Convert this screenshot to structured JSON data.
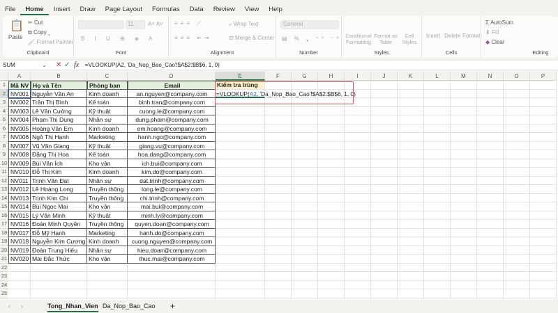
{
  "menu": [
    "File",
    "Home",
    "Insert",
    "Draw",
    "Page Layout",
    "Formulas",
    "Data",
    "Review",
    "View",
    "Help"
  ],
  "ribbon": {
    "clipboard": {
      "paste": "Paste",
      "cut": "Cut",
      "copy": "Copy",
      "format_painter": "Format Painter",
      "label": "Clipboard"
    },
    "font": {
      "size": "11",
      "label": "Font"
    },
    "alignment": {
      "wrap": "Wrap Text",
      "merge": "Merge & Center",
      "label": "Alignment"
    },
    "number": {
      "format": "General",
      "label": "Number"
    },
    "styles": {
      "conditional": "Conditional Formatting",
      "format_table": "Format as Table",
      "cell_styles": "Cell Styles",
      "label": "Styles"
    },
    "cells": {
      "insert": "Insert",
      "delete": "Delete",
      "format": "Format",
      "label": "Cells"
    },
    "editing": {
      "autosum": "AutoSum",
      "fill": "Fill",
      "clear": "Clear",
      "label": "Editing"
    }
  },
  "formula_bar": {
    "name_box": "SUM",
    "formula": "=VLOOKUP(A2, 'Da_Nop_Bao_Cao'!$A$2:$B$6, 1, 0)"
  },
  "columns": [
    "A",
    "B",
    "C",
    "D",
    "E",
    "F",
    "G",
    "H",
    "I",
    "J",
    "K",
    "L",
    "M",
    "N",
    "O",
    "P"
  ],
  "headers": [
    "Mã NV",
    "Họ và Tên",
    "Phòng ban",
    "Email",
    "Kiểm tra trùng"
  ],
  "rows": [
    [
      "NV001",
      "Nguyễn Văn An",
      "Kinh doanh",
      "an.nguyen@company.com"
    ],
    [
      "NV002",
      "Trần Thị Bình",
      "Kế toán",
      "binh.tran@company.com"
    ],
    [
      "NV003",
      "Lê Văn Cường",
      "Kỹ thuật",
      "cuong.le@company.com"
    ],
    [
      "NV004",
      "Phạm Thị Dung",
      "Nhân sự",
      "dung.pham@company.com"
    ],
    [
      "NV005",
      "Hoàng Văn Em",
      "Kinh doanh",
      "em.hoang@company.com"
    ],
    [
      "NV006",
      "Ngô Thị Hạnh",
      "Marketing",
      "hanh.ngo@company.com"
    ],
    [
      "NV007",
      "Vũ Văn Giang",
      "Kỹ thuật",
      "giang.vu@company.com"
    ],
    [
      "NV008",
      "Đặng Thị Hoa",
      "Kế toán",
      "hoa.dang@company.com"
    ],
    [
      "NV009",
      "Bùi Văn Ích",
      "Kho vận",
      "ich.bui@company.com"
    ],
    [
      "NV010",
      "Đỗ Thị Kim",
      "Kinh doanh",
      "kim.do@company.com"
    ],
    [
      "NV011",
      "Trịnh Văn Đạt",
      "Nhân sự",
      "dat.trinh@company.com"
    ],
    [
      "NV012",
      "Lê Hoàng Long",
      "Truyền thông",
      "long.le@company.com"
    ],
    [
      "NV013",
      "Trịnh Kim Chi",
      "Truyền thông",
      "chi.trinh@company.com"
    ],
    [
      "NV014",
      "Bùi Ngọc Mai",
      "Kho vận",
      "mai.bui@company.com"
    ],
    [
      "NV015",
      "Lý Văn Minh",
      "Kỹ thuật",
      "minh.ly@company.com"
    ],
    [
      "NV016",
      "Đoàn Minh Quyền",
      "Truyền thông",
      "quyen.doan@company.com"
    ],
    [
      "NV017",
      "Đỗ Mỹ Hạnh",
      "Marketing",
      "hanh.do@company.com"
    ],
    [
      "NV018",
      "Nguyễn Kim Cương",
      "Kinh doanh",
      "cuong.nguyen@company.com"
    ],
    [
      "NV019",
      "Đoàn Trung Hiếu",
      "Nhân sự",
      "hieu.doan@company.com"
    ],
    [
      "NV020",
      "Mai Đắc Thức",
      "Kho vận",
      "thuc.mai@company.com"
    ]
  ],
  "sheets": [
    "Tong_Nhan_Vien",
    "Da_Nop_Bao_Cao"
  ],
  "add_sheet": "+",
  "colors": {
    "accent": "#1e7145",
    "header_fill": "#e2efda",
    "highlight_fill": "#fff2cc",
    "annotation": "#d9534f"
  }
}
